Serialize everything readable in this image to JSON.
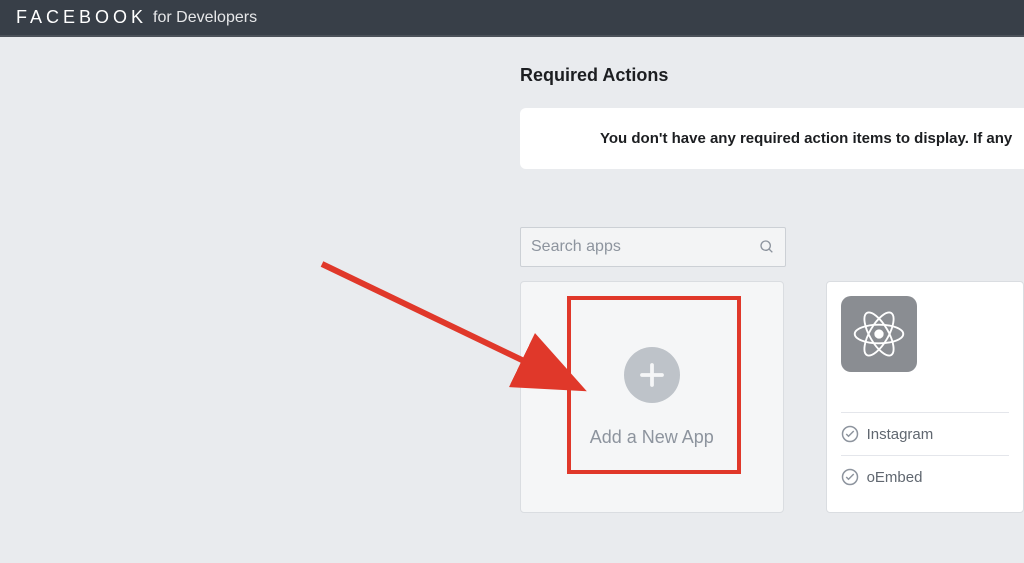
{
  "header": {
    "brand": "FACEBOOK",
    "suffix": "for Developers"
  },
  "main": {
    "section_title": "Required Actions",
    "empty_message": "You don't have any required action items to display. If any",
    "search": {
      "placeholder": "Search apps"
    },
    "add_app_label": "Add a New App",
    "app_card": {
      "features": [
        "Instagram",
        "oEmbed"
      ]
    }
  }
}
